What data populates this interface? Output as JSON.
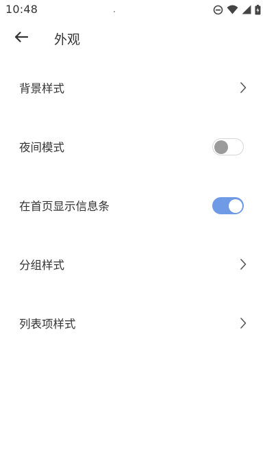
{
  "status_bar": {
    "time": "10:48",
    "icons": [
      "do-not-disturb-icon",
      "wifi-icon",
      "signal-icon",
      "battery-icon"
    ]
  },
  "app_bar": {
    "back_icon": "arrow-left-icon",
    "title": "外观"
  },
  "settings": [
    {
      "label": "背景样式",
      "control": "chevron"
    },
    {
      "label": "夜间模式",
      "control": "toggle",
      "on": false
    },
    {
      "label": "在首页显示信息条",
      "control": "toggle",
      "on": true
    },
    {
      "label": "分组样式",
      "control": "chevron"
    },
    {
      "label": "列表项样式",
      "control": "chevron"
    }
  ],
  "colors": {
    "toggle_on": "#6f9be6",
    "toggle_off_knob": "#9b9b9b",
    "text": "#333333",
    "background": "#ffffff"
  }
}
